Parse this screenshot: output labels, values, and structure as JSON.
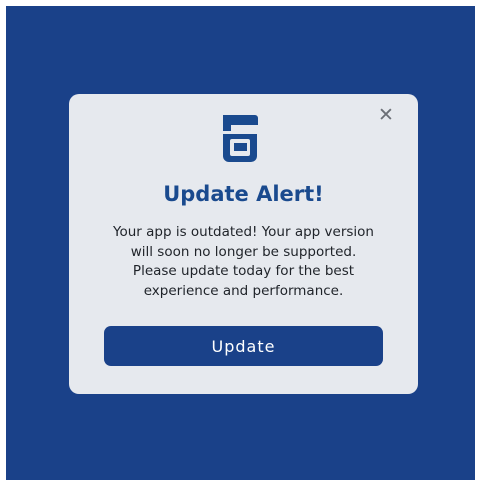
{
  "modal": {
    "close_glyph": "✕",
    "logo_icon": "app-logo-icon",
    "title": "Update Alert!",
    "message_lines": [
      "Your app is outdated! Your app version",
      "will soon no longer be supported.",
      "Please update today for the best",
      "experience and performance."
    ],
    "button_label": "Update"
  },
  "colors": {
    "background": "#1a4189",
    "modal": "#e6e9ee",
    "title": "#1a4a8e",
    "button": "#1a4189",
    "button_text": "#ffffff"
  }
}
